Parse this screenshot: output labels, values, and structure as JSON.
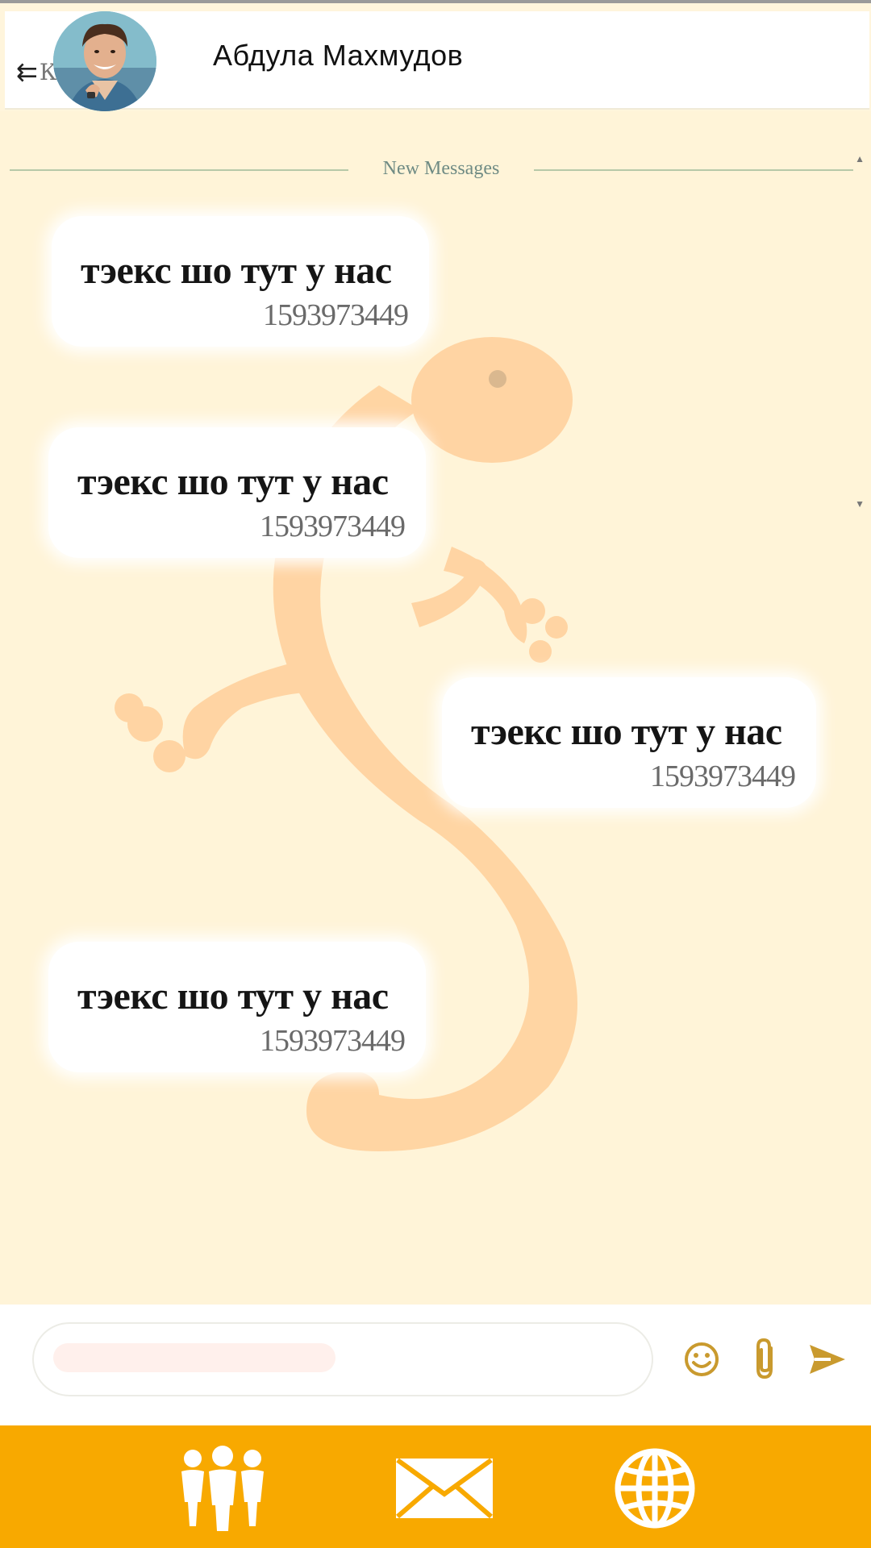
{
  "header": {
    "back_arrow": "⇇",
    "back_label": "К",
    "contact_name": "Абдула Махмудов",
    "avatar_icon": "user-avatar-photo"
  },
  "chat": {
    "divider_label": "New Messages",
    "messages": [
      {
        "text": "тэекс шо тут у нас",
        "time": "1593973449",
        "side": "incoming"
      },
      {
        "text": "тэекс шо тут у нас",
        "time": "1593973449",
        "side": "incoming"
      },
      {
        "text": "тэекс шо тут у нас",
        "time": "1593973449",
        "side": "outgoing"
      },
      {
        "text": "тэекс шо тут у нас",
        "time": "1593973449",
        "side": "incoming"
      }
    ],
    "background_icon": "gecko-watermark",
    "background_color": "#fff4d8",
    "watermark_color": "#ffc890"
  },
  "composer": {
    "input_value": "",
    "input_placeholder": "",
    "emoji_icon": "smiley-icon",
    "attach_icon": "paperclip-icon",
    "send_icon": "send-icon",
    "icon_color": "#c99a2e"
  },
  "bottom_nav": {
    "background_color": "#f8a900",
    "items": [
      {
        "icon": "people-icon"
      },
      {
        "icon": "envelope-icon"
      },
      {
        "icon": "globe-icon"
      }
    ]
  }
}
